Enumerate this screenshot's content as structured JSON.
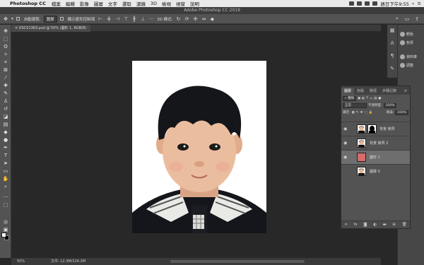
{
  "menubar": {
    "app_name": "Photoshop CC",
    "items": [
      "檔案",
      "編輯",
      "影像",
      "圖層",
      "文字",
      "選取",
      "濾鏡",
      "3D",
      "檢視",
      "視窗",
      "說明"
    ],
    "clock": "週日下午9:55"
  },
  "window_title": "Adobe Photoshop CC 2019",
  "options_bar": {
    "auto_select_label": "自動選取:",
    "auto_select_value": "圖層",
    "show_transform_label": "顯示變形控制項",
    "mode_3d_label": "3D 模式:"
  },
  "document": {
    "tab_label": "DSC01363.psd @ 50% (圖形 1, RGB/8)",
    "zoom": "50%",
    "doc_size": "文件: 12.3M/224.2M"
  },
  "right_panel": {
    "items": [
      "顏色",
      "色票",
      "資料庫",
      "調整"
    ]
  },
  "layers_panel": {
    "tabs": [
      "圖層",
      "色版",
      "路徑",
      "步驟記錄"
    ],
    "filter_label": "種類",
    "blend_mode": "正常",
    "opacity_label": "不透明度:",
    "opacity_value": "100%",
    "lock_label": "鎖定:",
    "fill_label": "填滿:",
    "fill_value": "100%",
    "layers": [
      {
        "name": "背景 拷貝",
        "selected": false,
        "visible": true
      },
      {
        "name": "背景 拷貝 2",
        "selected": false,
        "visible": true
      },
      {
        "name": "圖形 1",
        "selected": true,
        "visible": true
      },
      {
        "name": "圖層 0",
        "selected": false,
        "visible": false
      }
    ]
  },
  "colors": {
    "panel_bg": "#535353",
    "canvas_bg": "#282828",
    "layer_selected": "#6e6e6e",
    "shape_layer_fill": "#d96b6b"
  }
}
